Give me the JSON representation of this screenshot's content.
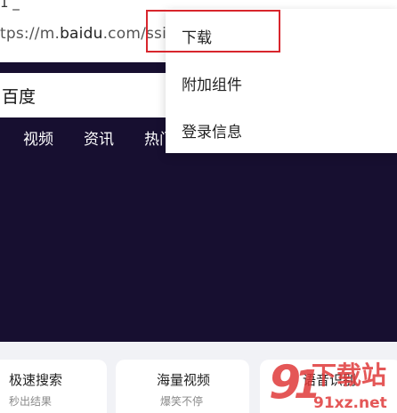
{
  "status_fragment": "1 _",
  "address_bar": {
    "prefix": "tps://m.",
    "domain": "baidu",
    "suffix": ".com/ssid="
  },
  "search": {
    "text": "百度"
  },
  "nav_items": [
    "视频",
    "资讯",
    "热门"
  ],
  "menu": {
    "items": [
      {
        "label": "下载",
        "highlighted": true
      },
      {
        "label": "附加组件",
        "highlighted": false
      },
      {
        "label": "登录信息",
        "highlighted": false
      }
    ]
  },
  "cards": [
    {
      "title": "极速搜索",
      "subtitle": "秒出结果"
    },
    {
      "title": "海量视频",
      "subtitle": "爆笑不停"
    },
    {
      "title": "语音识别",
      "subtitle": ""
    }
  ],
  "watermark": {
    "brand": "下载站",
    "site": "91xz.net"
  },
  "colors": {
    "hero_bg": "#170f30",
    "highlight": "#d8262d",
    "card_bg": "#f1f2f6",
    "watermark_red": "#e03a3a"
  }
}
